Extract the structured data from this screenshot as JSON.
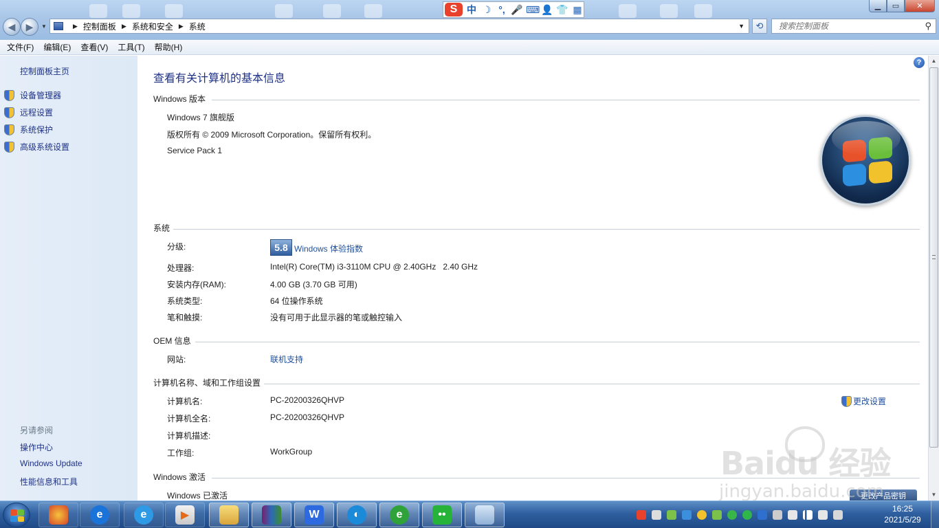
{
  "ime": {
    "logo": "S",
    "items": [
      "中",
      "☽",
      "°,",
      "🎤",
      "⌨",
      "👤",
      "👕",
      "▦"
    ]
  },
  "address": {
    "crumbs": [
      "控制面板",
      "系统和安全",
      "系统"
    ],
    "search_placeholder": "搜索控制面板"
  },
  "menu": [
    "文件(F)",
    "编辑(E)",
    "查看(V)",
    "工具(T)",
    "帮助(H)"
  ],
  "sidebar": {
    "home": "控制面板主页",
    "tasks": [
      "设备管理器",
      "远程设置",
      "系统保护",
      "高级系统设置"
    ],
    "see_also_title": "另请参阅",
    "see_also": [
      "操作中心",
      "Windows Update",
      "性能信息和工具"
    ]
  },
  "main": {
    "title": "查看有关计算机的基本信息",
    "edition": {
      "heading": "Windows 版本",
      "name": "Windows 7 旗舰版",
      "copyright": "版权所有 © 2009 Microsoft Corporation。保留所有权利。",
      "service_pack": "Service Pack 1"
    },
    "system": {
      "heading": "系统",
      "rating_label": "分级:",
      "rating_score": "5.8",
      "rating_link": "Windows 体验指数",
      "processor_label": "处理器:",
      "processor_value": "Intel(R) Core(TM) i3-3110M CPU @ 2.40GHz   2.40 GHz",
      "ram_label": "安装内存(RAM):",
      "ram_value": "4.00 GB (3.70 GB 可用)",
      "type_label": "系统类型:",
      "type_value": "64 位操作系统",
      "pen_label": "笔和触摸:",
      "pen_value": "没有可用于此显示器的笔或触控输入"
    },
    "oem": {
      "heading": "OEM 信息",
      "website_label": "网站:",
      "website_value": "联机支持"
    },
    "computer": {
      "heading": "计算机名称、域和工作组设置",
      "name_label": "计算机名:",
      "name_value": "PC-20200326QHVP",
      "fullname_label": "计算机全名:",
      "fullname_value": "PC-20200326QHVP",
      "desc_label": "计算机描述:",
      "workgroup_label": "工作组:",
      "workgroup_value": "WorkGroup",
      "change_settings": "更改设置"
    },
    "activation": {
      "heading": "Windows 激活",
      "status": "Windows 已激活"
    }
  },
  "watermark": {
    "brand": "Baidu 经验",
    "url": "jingyan.baidu.com"
  },
  "overlay_button": "更改产品密钥",
  "taskbar": {
    "time": "16:25",
    "date": "2021/5/29"
  },
  "colors": {
    "link": "#1e4f9c",
    "title": "#1e3287",
    "taskbar": "#2f5f9f"
  }
}
